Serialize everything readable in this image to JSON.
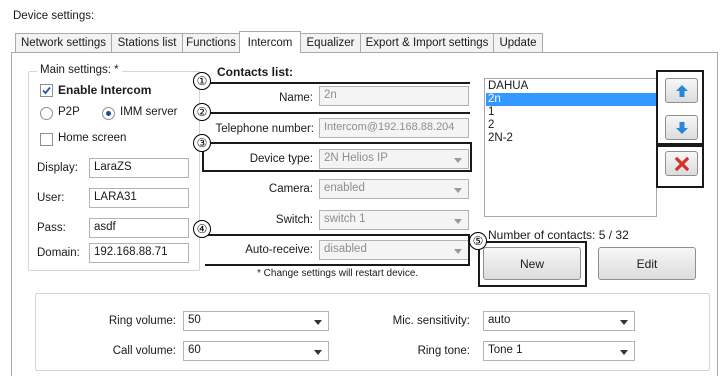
{
  "window_title": "Device settings:",
  "tabs": [
    "Network settings",
    "Stations list",
    "Functions",
    "Intercom",
    "Equalizer",
    "Export & Import settings",
    "Update"
  ],
  "main_settings": {
    "title": "Main settings: *",
    "enable_intercom": "Enable Intercom",
    "p2p": "P2P",
    "imm_server": "IMM server",
    "home_screen": "Home screen",
    "display_label": "Display:",
    "display_value": "LaraZS",
    "user_label": "User:",
    "user_value": "LARA31",
    "pass_label": "Pass:",
    "pass_value": "asdf",
    "domain_label": "Domain:",
    "domain_value": "192.168.88.71"
  },
  "contacts": {
    "title": "Contacts list:",
    "name_label": "Name:",
    "name_value": "2n",
    "tel_label": "Telephone number:",
    "tel_value": "Intercom@192.168.88.204",
    "device_type_label": "Device type:",
    "device_type_value": "2N Helios IP",
    "camera_label": "Camera:",
    "camera_value": "enabled",
    "switch_label": "Switch:",
    "switch_value": "switch 1",
    "auto_receive_label": "Auto-receive:",
    "auto_receive_value": "disabled",
    "note": "* Change settings will restart device.",
    "list": [
      "DAHUA",
      "2n",
      "1",
      "2",
      "2N-2"
    ],
    "count_text": "Number of contacts: 5 / 32",
    "new_button": "New",
    "edit_button": "Edit"
  },
  "audio": {
    "ring_volume_label": "Ring volume:",
    "ring_volume_value": "50",
    "call_volume_label": "Call volume:",
    "call_volume_value": "60",
    "mic_label": "Mic. sensitivity:",
    "mic_value": "auto",
    "ring_tone_label": "Ring tone:",
    "ring_tone_value": "Tone 1"
  },
  "callouts": [
    "①",
    "②",
    "③",
    "④",
    "⑤"
  ],
  "colors": {
    "selection": "#3399ff",
    "arrow_blue": "#2b86d8",
    "delete_red": "#d9302a"
  }
}
